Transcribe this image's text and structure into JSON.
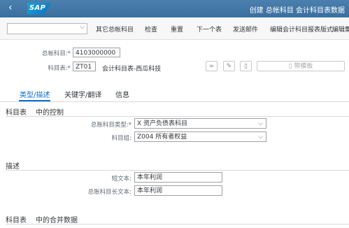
{
  "shell": {
    "brand": "SAP",
    "title": "创建 总帐科目 会计科目表数据"
  },
  "toolbar": {
    "items": [
      "其它总帐科目",
      "检查",
      "重置",
      "下一个表",
      "发送邮件",
      "编辑会计科目报表版式",
      "编辑集"
    ]
  },
  "header": {
    "gl_account_label": "总帐科目:*",
    "gl_account_value": "4103000000",
    "coa_label": "科目表:*",
    "coa_value": "ZT01",
    "coa_desc": "会计科目表-西瓜科技",
    "template_button": "带模板"
  },
  "tabs": [
    "类型/描述",
    "关键字/翻译",
    "信息"
  ],
  "sections": {
    "control": {
      "title_a": "科目表",
      "title_b": "中的控制",
      "account_type_label": "总账科目类型:*",
      "account_type_value": "X 资产负债表科目",
      "account_group_label": "科目组:",
      "account_group_value": "Z004 所有者权益"
    },
    "description": {
      "title": "描述",
      "short_text_label": "短文本:",
      "short_text_value": "本年利润",
      "long_text_label": "总账科目长文本:",
      "long_text_value": "本年利润"
    },
    "consolidation": {
      "title_a": "科目表",
      "title_b": "中的合并数据"
    }
  },
  "colors": {
    "shell": "#3a6f9f",
    "accent": "#0a6ed1"
  }
}
